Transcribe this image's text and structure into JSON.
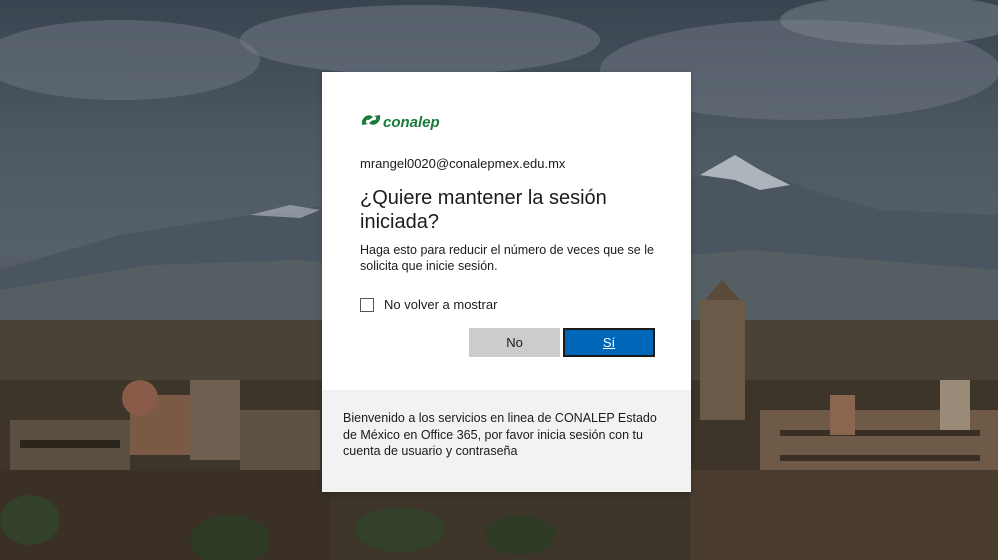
{
  "logo": {
    "text": "conalep",
    "brand_color": "#1a7a3c"
  },
  "identity": {
    "email": "mrangel0020@conalepmex.edu.mx"
  },
  "prompt": {
    "title": "¿Quiere mantener la sesión iniciada?",
    "description": "Haga esto para reducir el número de veces que se le solicita que inicie sesión."
  },
  "checkbox": {
    "label": "No volver a mostrar",
    "checked": false
  },
  "buttons": {
    "no_label": "No",
    "yes_label": "Sí",
    "yes_color": "#0067b8"
  },
  "footer": {
    "text": "Bienvenido a los servicios en linea de CONALEP Estado de México en Office 365, por favor inicia sesión con tu cuenta de usuario y contraseña"
  }
}
